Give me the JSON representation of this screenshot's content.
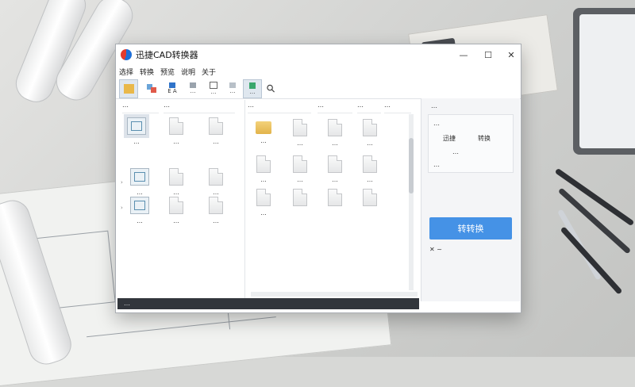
{
  "window": {
    "title": "迅捷CAD转换器",
    "controls": {
      "minimize": "—",
      "maximize": "☐",
      "close": "✕"
    }
  },
  "menu": [
    "选择",
    "转换",
    "预览",
    "说明",
    "关于"
  ],
  "toolbar": [
    {
      "label": "",
      "icon": "folder-open-icon"
    },
    {
      "label": "",
      "icon": "convert-icon"
    },
    {
      "label": "E A",
      "icon": "export-icon"
    },
    {
      "label": "…",
      "icon": "settings-icon"
    },
    {
      "label": "…",
      "icon": "help-icon"
    },
    {
      "label": "…",
      "icon": "layer-icon"
    },
    {
      "label": "…",
      "icon": "cursor-icon"
    },
    {
      "label": "",
      "icon": "search-icon"
    }
  ],
  "left_panel": {
    "headers": [
      "…",
      "…"
    ],
    "files": [
      "…",
      "…",
      "…",
      "…",
      "…",
      "…",
      "…",
      "…",
      "…"
    ]
  },
  "mid_panel": {
    "headers": [
      "…",
      "…",
      "…",
      "…"
    ],
    "files": [
      "…",
      "…",
      "…",
      "…",
      "…",
      "…",
      "…",
      "…",
      "…"
    ]
  },
  "right_panel": {
    "title": "…",
    "lines": [
      "…",
      "迅捷",
      "转换",
      "…",
      "…"
    ],
    "convert_label": "转转换",
    "footer": "✕ ~"
  },
  "status": {
    "text": "…"
  },
  "colors": {
    "accent": "#4592e6",
    "status_bg": "#32363c",
    "folder": "#e2b34a"
  }
}
